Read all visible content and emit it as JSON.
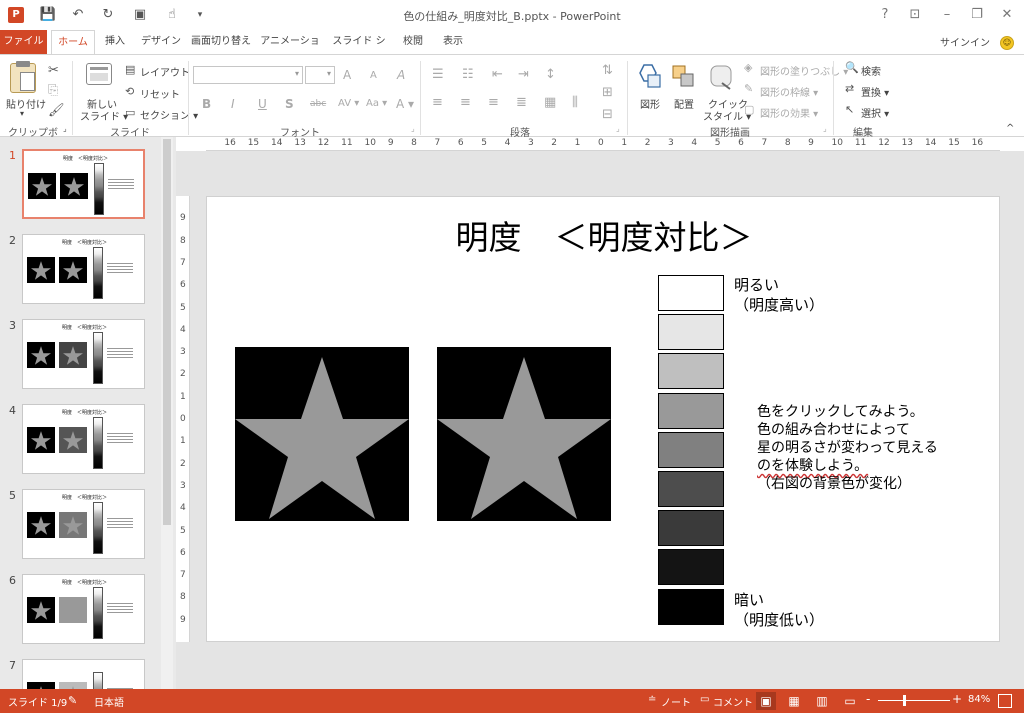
{
  "window": {
    "title": "色の仕組み_明度対比_B.pptx - PowerPoint",
    "help": "?",
    "minimize": "–",
    "restore": "❐",
    "close": "✕",
    "ribbon_display": "⊡"
  },
  "qat": {
    "save": "💾",
    "undo": "↶",
    "redo": "↻",
    "present": "▣",
    "touch": "☝",
    "customize": "▾"
  },
  "tabs": {
    "file": "ファイル",
    "items": [
      "ホーム",
      "挿入",
      "デザイン",
      "画面切り替え",
      "アニメーション",
      "スライド ショー",
      "校閲",
      "表示"
    ],
    "active": "ホーム",
    "signin": "サインイン"
  },
  "ribbon": {
    "clipboard": {
      "label": "クリップボード",
      "paste": "貼り付け",
      "paste_arrow": "▾"
    },
    "slides": {
      "label": "スライド",
      "new_slide_1": "新しい",
      "new_slide_2": "スライド ▾",
      "layout": "レイアウト ▾",
      "reset": "リセット",
      "section": "セクション ▾"
    },
    "font": {
      "label": "フォント",
      "font_name": "",
      "font_size": "",
      "bold": "B",
      "italic": "I",
      "underline": "U",
      "shadow": "S",
      "strike": "abc",
      "spacing": "AV ▾",
      "case": "Aa ▾",
      "color": "A ▾",
      "grow": "A",
      "shrink": "A",
      "clear": "A"
    },
    "paragraph": {
      "label": "段落"
    },
    "drawing": {
      "label": "図形描画",
      "shapes": "図形",
      "arrange": "配置",
      "quick_style_1": "クイック",
      "quick_style_2": "スタイル ▾",
      "fill": "図形の塗りつぶし ▾",
      "outline": "図形の枠線 ▾",
      "effects": "図形の効果 ▾"
    },
    "editing": {
      "label": "編集",
      "find": "検索",
      "replace": "置換 ▾",
      "select": "選択 ▾"
    },
    "collapse": "^"
  },
  "thumbnails": [
    {
      "num": "1",
      "title": "明度　＜明度対比＞",
      "b1": "#000000",
      "b2": "#000000"
    },
    {
      "num": "2",
      "title": "明度　＜明度対比＞",
      "b1": "#000000",
      "b2": "#000000"
    },
    {
      "num": "3",
      "title": "明度　＜明度対比＞",
      "b1": "#000000",
      "b2": "#444444"
    },
    {
      "num": "4",
      "title": "明度　＜明度対比＞",
      "b1": "#000000",
      "b2": "#555555"
    },
    {
      "num": "5",
      "title": "明度　＜明度対比＞",
      "b1": "#000000",
      "b2": "#777777"
    },
    {
      "num": "6",
      "title": "明度　＜明度対比＞",
      "b1": "#000000",
      "b2": "#999999"
    },
    {
      "num": "7",
      "title": "",
      "b1": "#000000",
      "b2": "#bbbbbb"
    }
  ],
  "ruler": {
    "h_ticks": [
      "16",
      "15",
      "14",
      "13",
      "12",
      "11",
      "10",
      "9",
      "8",
      "7",
      "6",
      "5",
      "4",
      "3",
      "2",
      "1",
      "0",
      "1",
      "2",
      "3",
      "4",
      "5",
      "6",
      "7",
      "8",
      "9",
      "10",
      "11",
      "12",
      "13",
      "14",
      "15",
      "16"
    ],
    "v_ticks": [
      "9",
      "8",
      "7",
      "6",
      "5",
      "4",
      "3",
      "2",
      "1",
      "0",
      "1",
      "2",
      "3",
      "4",
      "5",
      "6",
      "7",
      "8",
      "9"
    ]
  },
  "slide": {
    "title": "明度　＜明度対比＞",
    "left_box_color": "#000000",
    "right_box_color": "#000000",
    "star_color": "#999999",
    "swatches": [
      "#ffffff",
      "#e6e6e6",
      "#bfbfbf",
      "#999999",
      "#808080",
      "#4d4d4d",
      "#3a3a3a",
      "#141414",
      "#000000"
    ],
    "bright_label": "明るい",
    "bright_sub": "（明度高い）",
    "dark_label": "暗い",
    "dark_sub": "（明度低い）",
    "instructions": [
      "色をクリックしてみよう。",
      "色の組み合わせによって",
      "星の明るさが変わって見える",
      "のを体験しよう。",
      "（右図の背景色が変化）"
    ]
  },
  "status": {
    "slide_info": "スライド 1/9",
    "language": "日本語",
    "notes": "ノート",
    "comments": "コメント",
    "zoom_minus": "-",
    "zoom_plus": "+",
    "zoom": "84%"
  }
}
